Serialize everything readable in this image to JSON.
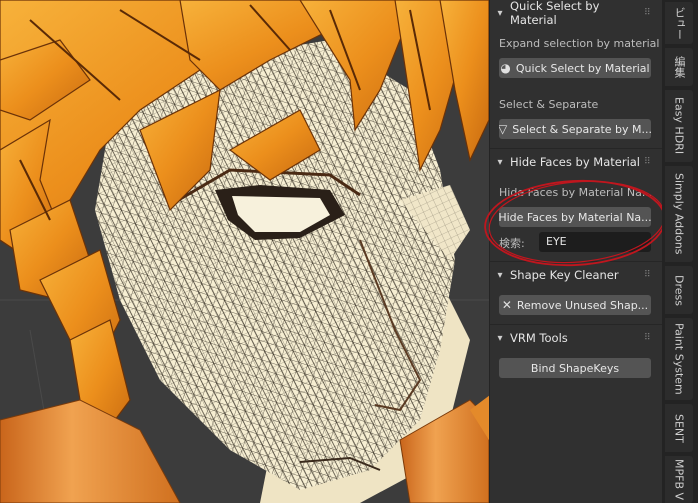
{
  "panels": {
    "quick_select": {
      "title": "Quick Select by Material",
      "description": "Expand selection by material",
      "button_label": "Quick Select by Material",
      "section2_label": "Select & Separate",
      "section2_button": "Select & Separate by M..."
    },
    "hide_faces": {
      "title": "Hide Faces by Material",
      "description": "Hide Faces by Material Na...",
      "button_label": "Hide Faces by Material Na...",
      "search_label": "検索:",
      "search_value": "EYE"
    },
    "shape_key_cleaner": {
      "title": "Shape Key Cleaner",
      "button_label": "Remove Unused Shap..."
    },
    "vrm_tools": {
      "title": "VRM Tools",
      "button_label": "Bind ShapeKeys"
    }
  },
  "tabs": [
    "ビュー",
    "編集",
    "Easy HDRI",
    "Simply Addons",
    "Dress",
    "Paint System",
    "SENT",
    "MPFB V"
  ],
  "icons": {
    "collapse": "chevron-down-icon",
    "grip": "drag-handle-icon",
    "material": "material-sphere-icon",
    "separate": "separate-mesh-icon",
    "remove": "x-icon"
  },
  "colors": {
    "panel_bg": "#303030",
    "button_bg": "#545454",
    "field_bg": "#1d1d1d",
    "annotation": "#c0161e",
    "hair": "#f09a22",
    "skin": "#f5edcf"
  }
}
